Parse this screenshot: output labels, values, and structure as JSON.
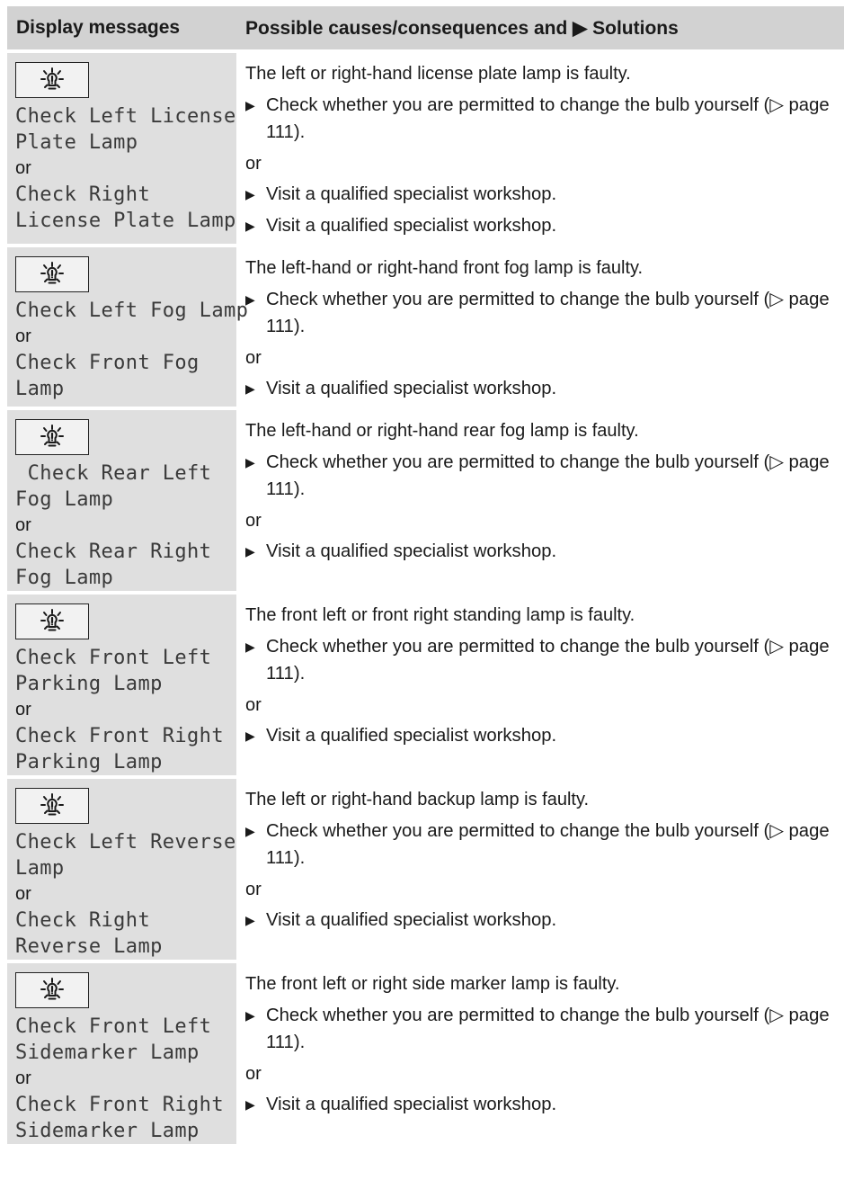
{
  "header": {
    "col1": "Display messages",
    "col2": "Possible causes/consequences and ▶ Solutions"
  },
  "bullet": "▶",
  "icon": "bulb-warning-icon",
  "rows": [
    {
      "display": [
        "Check Left License",
        "Plate Lamp",
        "or",
        "Check Right",
        "License Plate Lamp"
      ],
      "cause": "The left or right-hand license plate lamp is faulty.",
      "steps": [
        {
          "type": "step",
          "text": "Check whether you are permitted to change the bulb yourself (▷ page 111)."
        },
        {
          "type": "or",
          "text": "or"
        },
        {
          "type": "step",
          "text": "Visit a qualified specialist workshop."
        },
        {
          "type": "step",
          "text": "Visit a qualified specialist workshop."
        }
      ]
    },
    {
      "display": [
        "Check Left Fog Lamp",
        "or",
        "Check Front Fog",
        "Lamp"
      ],
      "cause": "The left-hand or right-hand front fog lamp is faulty.",
      "steps": [
        {
          "type": "step",
          "text": "Check whether you are permitted to change the bulb yourself (▷ page 111)."
        },
        {
          "type": "or",
          "text": "or"
        },
        {
          "type": "step",
          "text": "Visit a qualified specialist workshop."
        }
      ]
    },
    {
      "display": [
        " Check Rear Left",
        "Fog Lamp",
        "or",
        "Check Rear Right",
        "Fog Lamp"
      ],
      "cause": "The left-hand or right-hand rear fog lamp is faulty.",
      "steps": [
        {
          "type": "step",
          "text": "Check whether you are permitted to change the bulb yourself (▷ page 111)."
        },
        {
          "type": "or",
          "text": "or"
        },
        {
          "type": "step",
          "text": "Visit a qualified specialist workshop."
        }
      ]
    },
    {
      "display": [
        "Check Front Left",
        "Parking Lamp",
        "or",
        "Check Front Right",
        "Parking Lamp"
      ],
      "cause": "The front left or front right standing lamp is faulty.",
      "steps": [
        {
          "type": "step",
          "text": "Check whether you are permitted to change the bulb yourself (▷ page 111)."
        },
        {
          "type": "or",
          "text": "or"
        },
        {
          "type": "step",
          "text": "Visit a qualified specialist workshop."
        }
      ]
    },
    {
      "display": [
        "Check Left Reverse",
        "Lamp",
        "or",
        "Check Right",
        "Reverse Lamp"
      ],
      "cause": "The left or right-hand backup lamp is faulty.",
      "steps": [
        {
          "type": "step",
          "text": "Check whether you are permitted to change the bulb yourself (▷ page 111)."
        },
        {
          "type": "or",
          "text": "or"
        },
        {
          "type": "step",
          "text": "Visit a qualified specialist workshop."
        }
      ]
    },
    {
      "display": [
        "Check Front Left",
        "Sidemarker Lamp",
        "or",
        "Check Front Right",
        "Sidemarker Lamp"
      ],
      "cause": "The front left or right side marker lamp is faulty.",
      "steps": [
        {
          "type": "step",
          "text": "Check whether you are permitted to change the bulb yourself (▷ page 111)."
        },
        {
          "type": "or",
          "text": "or"
        },
        {
          "type": "step",
          "text": "Visit a qualified specialist workshop."
        }
      ]
    }
  ]
}
